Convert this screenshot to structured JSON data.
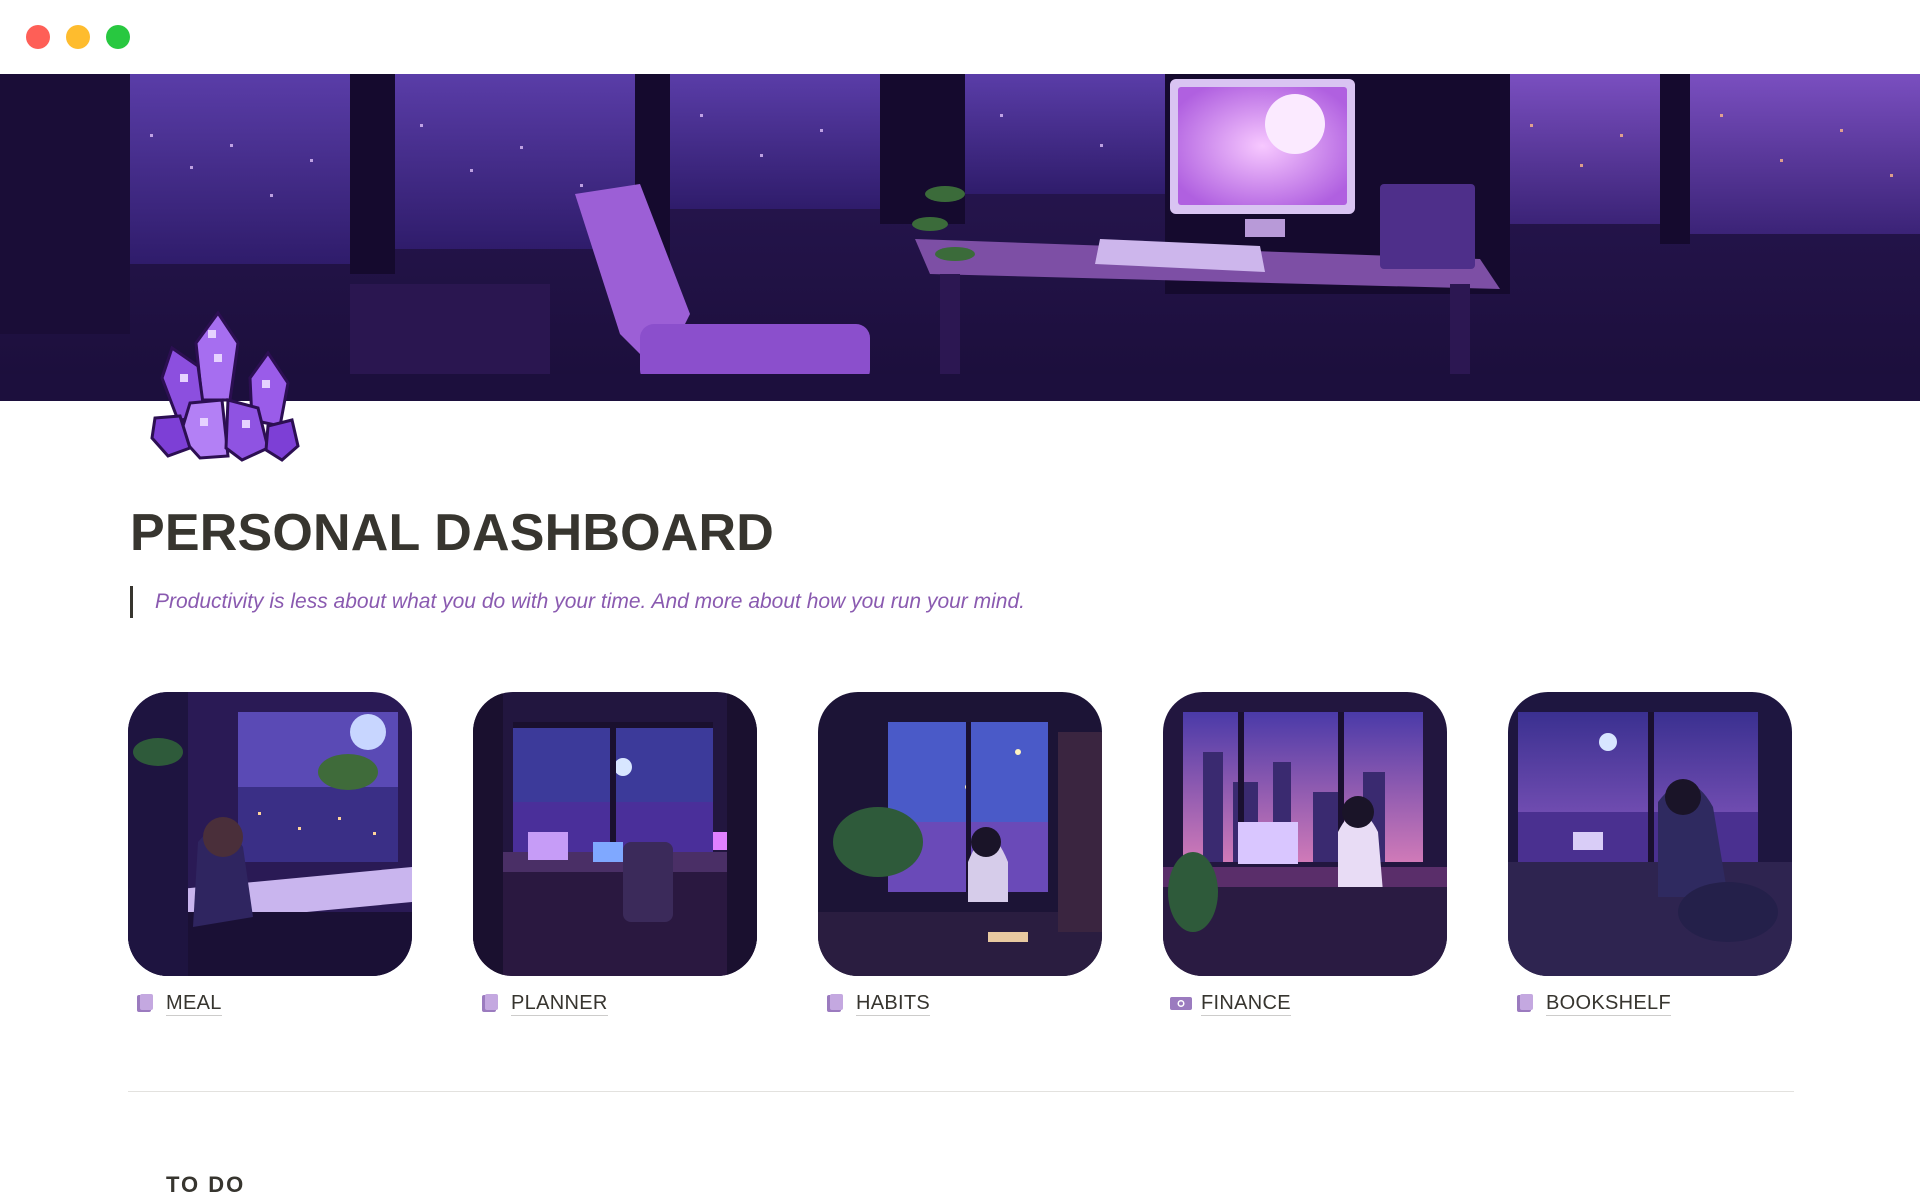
{
  "window": {
    "controls": [
      "close",
      "minimize",
      "zoom"
    ],
    "colors": {
      "close": "#fe5f57",
      "minimize": "#febc2e",
      "zoom": "#28c840"
    }
  },
  "cover": {
    "icon": "cover-image-purple-night-desk"
  },
  "page": {
    "icon": "amethyst-crystal-icon",
    "title": "PERSONAL DASHBOARD",
    "quote": "Productivity is less about what you do with your time. And more about how you run your mind."
  },
  "gallery": {
    "cards": [
      {
        "label": "MEAL",
        "icon": "page-icon"
      },
      {
        "label": "PLANNER",
        "icon": "page-icon"
      },
      {
        "label": "HABITS",
        "icon": "page-icon"
      },
      {
        "label": "FINANCE",
        "icon": "money-icon"
      },
      {
        "label": "BOOKSHELF",
        "icon": "page-icon"
      }
    ]
  },
  "next_section": {
    "heading": "TO DO"
  },
  "colors": {
    "accent": "#8a5ab0",
    "text": "#37352f",
    "cover_purple": "#3b1e73"
  }
}
